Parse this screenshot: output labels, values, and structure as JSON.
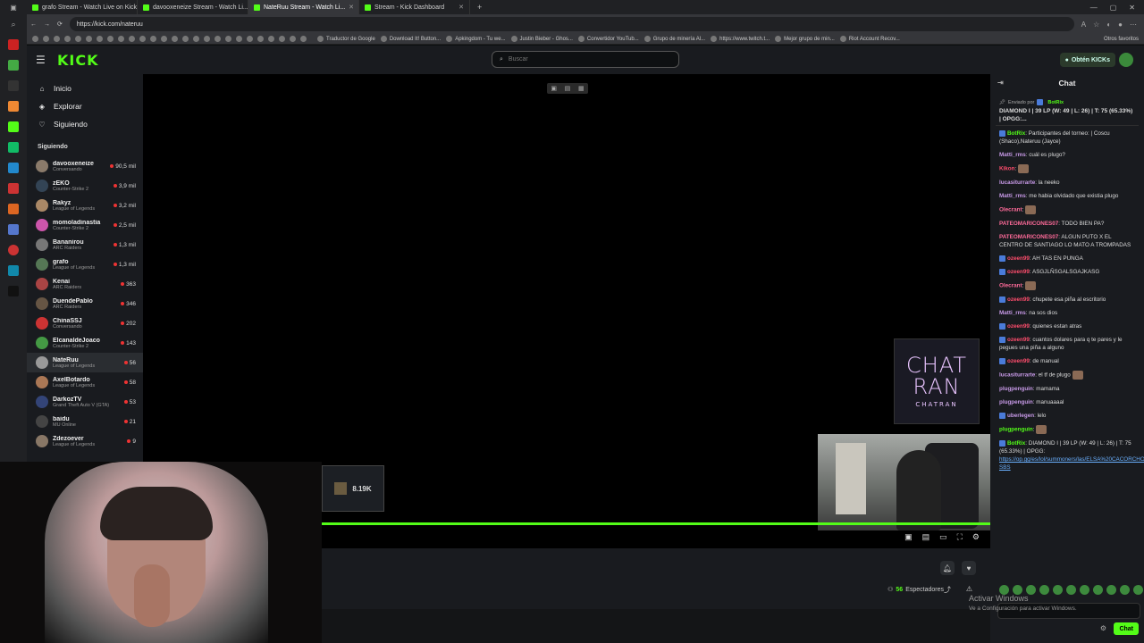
{
  "browser": {
    "tabs": [
      {
        "label": "grafo Stream - Watch Live on Kick",
        "active": false
      },
      {
        "label": "davooxeneize Stream - Watch Li...",
        "active": false
      },
      {
        "label": "NateRuu Stream - Watch Li...",
        "active": true
      },
      {
        "label": "Stream - Kick Dashboard",
        "active": false
      }
    ],
    "new_tab": "+",
    "url": "https://kick.com/nateruu",
    "bookmarks": [
      "Traductor de Google",
      "Download It! Button...",
      "Apkingdom - Tu we...",
      "Justin Bieber - Ghos...",
      "Convertidor YouTub...",
      "Grupo de minería Al...",
      "https://www.twitch.t...",
      "Mejor grupo de min...",
      "Riot Account Recov..."
    ],
    "other_bookmarks": "Otros favoritos"
  },
  "header": {
    "logo": "KICK",
    "search_placeholder": "Buscar",
    "kicks_button": "Obtén KICKs"
  },
  "nav": {
    "items": [
      {
        "label": "Inicio",
        "icon": "home-icon",
        "glyph": "⌂"
      },
      {
        "label": "Explorar",
        "icon": "compass-icon",
        "glyph": "◈"
      },
      {
        "label": "Siguiendo",
        "icon": "heart-icon",
        "glyph": "♡"
      }
    ],
    "following_title": "Siguiendo"
  },
  "channels": [
    {
      "name": "davooxeneize",
      "game": "Conversando",
      "viewers": "90,5 mil",
      "color": "#8a7a6a"
    },
    {
      "name": "zEKO",
      "game": "Counter-Strike 2",
      "viewers": "3,9 mil",
      "color": "#334455"
    },
    {
      "name": "Rakyz",
      "game": "League of Legends",
      "viewers": "3,2 mil",
      "color": "#aa8866"
    },
    {
      "name": "momoladinastia",
      "game": "Counter-Strike 2",
      "viewers": "2,5 mil",
      "color": "#cc55aa"
    },
    {
      "name": "Bananirou",
      "game": "ARC Raiders",
      "viewers": "1,3 mil",
      "color": "#777777"
    },
    {
      "name": "grafo",
      "game": "League of Legends",
      "viewers": "1,3 mil",
      "color": "#557755"
    },
    {
      "name": "Kenai",
      "game": "ARC Raiders",
      "viewers": "363",
      "color": "#aa4444"
    },
    {
      "name": "DuendePablo",
      "game": "ARC Raiders",
      "viewers": "346",
      "color": "#665544"
    },
    {
      "name": "ChinaSSJ",
      "game": "Conversando",
      "viewers": "202",
      "color": "#cc3333"
    },
    {
      "name": "ElcanaldeJoaco",
      "game": "Counter-Strike 2",
      "viewers": "143",
      "color": "#449944"
    },
    {
      "name": "NateRuu",
      "game": "League of Legends",
      "viewers": "56",
      "color": "#999999",
      "active": true
    },
    {
      "name": "AxelBotardo",
      "game": "League of Legends",
      "viewers": "58",
      "color": "#aa7755"
    },
    {
      "name": "DarkozTV",
      "game": "Grand Theft Auto V (GTA)",
      "viewers": "53",
      "color": "#334477"
    },
    {
      "name": "baidu",
      "game": "MU Online",
      "viewers": "21",
      "color": "#444444"
    },
    {
      "name": "Zdezoever",
      "game": "League of Legends",
      "viewers": "9",
      "color": "#887766"
    }
  ],
  "player": {
    "overlay_value": "8.19K",
    "chatran_line1": "CHAT",
    "chatran_line2": "RAN",
    "chatran_small": "CHATRAN",
    "progress_fraction": 1.0
  },
  "stream_info": {
    "viewers_count": "56",
    "viewers_label": "Espectadores"
  },
  "chat": {
    "title": "Chat",
    "pinned_sent_by": "Enviado por",
    "pinned_user": "BotRix",
    "pinned_text": "DIAMOND I | 39 LP (W: 49 | L: 26) | T: 75 (65.33%) | OPGG:...",
    "messages": [
      {
        "user": "BotRix",
        "color": "#53fc18",
        "badge": true,
        "text": ": Participantes del torneo: | Coscu (Shaco),Nateruu (Jayce)"
      },
      {
        "user": "Matti_rms",
        "color": "#c89ae8",
        "text": ": cuál es plugo?"
      },
      {
        "user": "Kikon",
        "color": "#ff4d6d",
        "text": ":",
        "emote": true
      },
      {
        "user": "lucasiturrarte",
        "color": "#c89ae8",
        "text": ": la neeko"
      },
      {
        "user": "Matti_rms",
        "color": "#c89ae8",
        "text": ": me habia olvidado que existia plugo"
      },
      {
        "user": "Olecrant",
        "color": "#ff6b9a",
        "text": ":",
        "emote": true
      },
      {
        "user": "PATEOMARICONES07",
        "color": "#ff6b9a",
        "text": ": TODO BIEN PA?"
      },
      {
        "user": "PATEOMARICONES07",
        "color": "#ff6b9a",
        "text": ": ALGUN PUTO X EL CENTRO DE SANTIAGO LO MATO A TROMPADAS"
      },
      {
        "user": "ozeen99",
        "color": "#ff4d6d",
        "badge": true,
        "text": ": AH TAS EN PUNGA"
      },
      {
        "user": "ozeen99",
        "color": "#ff4d6d",
        "badge": true,
        "text": ": ASGJLÑSGALSGAJKASG"
      },
      {
        "user": "Olecrant",
        "color": "#ff6b9a",
        "text": ":",
        "emote": true
      },
      {
        "user": "ozeen99",
        "color": "#ff4d6d",
        "badge": true,
        "text": ": chupete esa piña al escritorio"
      },
      {
        "user": "Matti_rms",
        "color": "#c89ae8",
        "text": ": na sos dios"
      },
      {
        "user": "ozeen99",
        "color": "#ff4d6d",
        "badge": true,
        "text": ": quienes estan atras"
      },
      {
        "user": "ozeen99",
        "color": "#ff4d6d",
        "badge": true,
        "text": ": cuantos dolares para q te pares y le pegues una piña a alguno"
      },
      {
        "user": "ozeen99",
        "color": "#ff4d6d",
        "badge": true,
        "text": ": de manual"
      },
      {
        "user": "lucasiturrarte",
        "color": "#c89ae8",
        "text": ": el tf de plugo",
        "emote": true
      },
      {
        "user": "plugpenguin",
        "color": "#c89ae8",
        "text": ": mamama"
      },
      {
        "user": "plugpenguin",
        "color": "#c89ae8",
        "text": ": manuaaaal"
      },
      {
        "user": "uberlegen",
        "color": "#c89ae8",
        "badge": true,
        "text": ": lelo"
      },
      {
        "user": "plugpenguin",
        "color": "#53fc18",
        "text": ":",
        "emote": true
      },
      {
        "user": "BotRix",
        "color": "#53fc18",
        "badge": true,
        "text": ": DIAMOND I | 39 LP (W: 49 | L: 26) | T: 75 (65.33%) | OPGG: ",
        "link": "https://op.gg/es/lol/summoners/las/ELSA%20CACORCHOS-SBS"
      }
    ],
    "activate_title": "Activar Windows",
    "activate_sub": "Ve a Configuración para activar Windows.",
    "send_label": "Chat"
  },
  "colors": {
    "accent": "#53fc18"
  }
}
